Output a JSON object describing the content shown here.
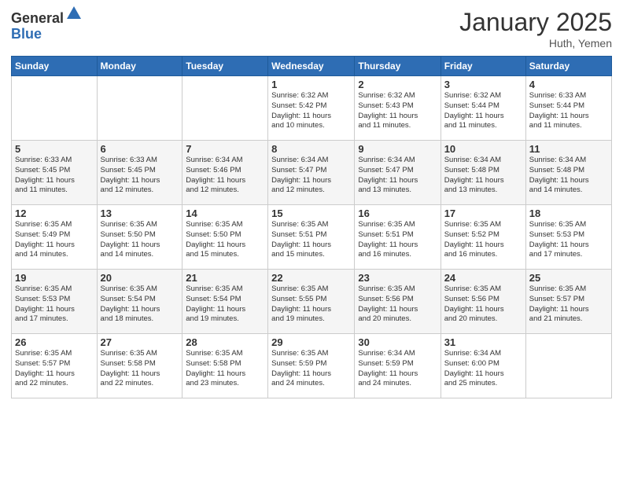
{
  "header": {
    "logo_general": "General",
    "logo_blue": "Blue",
    "title": "January 2025",
    "location": "Huth, Yemen"
  },
  "weekdays": [
    "Sunday",
    "Monday",
    "Tuesday",
    "Wednesday",
    "Thursday",
    "Friday",
    "Saturday"
  ],
  "weeks": [
    [
      {
        "day": "",
        "info": ""
      },
      {
        "day": "",
        "info": ""
      },
      {
        "day": "",
        "info": ""
      },
      {
        "day": "1",
        "info": "Sunrise: 6:32 AM\nSunset: 5:42 PM\nDaylight: 11 hours\nand 10 minutes."
      },
      {
        "day": "2",
        "info": "Sunrise: 6:32 AM\nSunset: 5:43 PM\nDaylight: 11 hours\nand 11 minutes."
      },
      {
        "day": "3",
        "info": "Sunrise: 6:32 AM\nSunset: 5:44 PM\nDaylight: 11 hours\nand 11 minutes."
      },
      {
        "day": "4",
        "info": "Sunrise: 6:33 AM\nSunset: 5:44 PM\nDaylight: 11 hours\nand 11 minutes."
      }
    ],
    [
      {
        "day": "5",
        "info": "Sunrise: 6:33 AM\nSunset: 5:45 PM\nDaylight: 11 hours\nand 11 minutes."
      },
      {
        "day": "6",
        "info": "Sunrise: 6:33 AM\nSunset: 5:45 PM\nDaylight: 11 hours\nand 12 minutes."
      },
      {
        "day": "7",
        "info": "Sunrise: 6:34 AM\nSunset: 5:46 PM\nDaylight: 11 hours\nand 12 minutes."
      },
      {
        "day": "8",
        "info": "Sunrise: 6:34 AM\nSunset: 5:47 PM\nDaylight: 11 hours\nand 12 minutes."
      },
      {
        "day": "9",
        "info": "Sunrise: 6:34 AM\nSunset: 5:47 PM\nDaylight: 11 hours\nand 13 minutes."
      },
      {
        "day": "10",
        "info": "Sunrise: 6:34 AM\nSunset: 5:48 PM\nDaylight: 11 hours\nand 13 minutes."
      },
      {
        "day": "11",
        "info": "Sunrise: 6:34 AM\nSunset: 5:48 PM\nDaylight: 11 hours\nand 14 minutes."
      }
    ],
    [
      {
        "day": "12",
        "info": "Sunrise: 6:35 AM\nSunset: 5:49 PM\nDaylight: 11 hours\nand 14 minutes."
      },
      {
        "day": "13",
        "info": "Sunrise: 6:35 AM\nSunset: 5:50 PM\nDaylight: 11 hours\nand 14 minutes."
      },
      {
        "day": "14",
        "info": "Sunrise: 6:35 AM\nSunset: 5:50 PM\nDaylight: 11 hours\nand 15 minutes."
      },
      {
        "day": "15",
        "info": "Sunrise: 6:35 AM\nSunset: 5:51 PM\nDaylight: 11 hours\nand 15 minutes."
      },
      {
        "day": "16",
        "info": "Sunrise: 6:35 AM\nSunset: 5:51 PM\nDaylight: 11 hours\nand 16 minutes."
      },
      {
        "day": "17",
        "info": "Sunrise: 6:35 AM\nSunset: 5:52 PM\nDaylight: 11 hours\nand 16 minutes."
      },
      {
        "day": "18",
        "info": "Sunrise: 6:35 AM\nSunset: 5:53 PM\nDaylight: 11 hours\nand 17 minutes."
      }
    ],
    [
      {
        "day": "19",
        "info": "Sunrise: 6:35 AM\nSunset: 5:53 PM\nDaylight: 11 hours\nand 17 minutes."
      },
      {
        "day": "20",
        "info": "Sunrise: 6:35 AM\nSunset: 5:54 PM\nDaylight: 11 hours\nand 18 minutes."
      },
      {
        "day": "21",
        "info": "Sunrise: 6:35 AM\nSunset: 5:54 PM\nDaylight: 11 hours\nand 19 minutes."
      },
      {
        "day": "22",
        "info": "Sunrise: 6:35 AM\nSunset: 5:55 PM\nDaylight: 11 hours\nand 19 minutes."
      },
      {
        "day": "23",
        "info": "Sunrise: 6:35 AM\nSunset: 5:56 PM\nDaylight: 11 hours\nand 20 minutes."
      },
      {
        "day": "24",
        "info": "Sunrise: 6:35 AM\nSunset: 5:56 PM\nDaylight: 11 hours\nand 20 minutes."
      },
      {
        "day": "25",
        "info": "Sunrise: 6:35 AM\nSunset: 5:57 PM\nDaylight: 11 hours\nand 21 minutes."
      }
    ],
    [
      {
        "day": "26",
        "info": "Sunrise: 6:35 AM\nSunset: 5:57 PM\nDaylight: 11 hours\nand 22 minutes."
      },
      {
        "day": "27",
        "info": "Sunrise: 6:35 AM\nSunset: 5:58 PM\nDaylight: 11 hours\nand 22 minutes."
      },
      {
        "day": "28",
        "info": "Sunrise: 6:35 AM\nSunset: 5:58 PM\nDaylight: 11 hours\nand 23 minutes."
      },
      {
        "day": "29",
        "info": "Sunrise: 6:35 AM\nSunset: 5:59 PM\nDaylight: 11 hours\nand 24 minutes."
      },
      {
        "day": "30",
        "info": "Sunrise: 6:34 AM\nSunset: 5:59 PM\nDaylight: 11 hours\nand 24 minutes."
      },
      {
        "day": "31",
        "info": "Sunrise: 6:34 AM\nSunset: 6:00 PM\nDaylight: 11 hours\nand 25 minutes."
      },
      {
        "day": "",
        "info": ""
      }
    ]
  ]
}
